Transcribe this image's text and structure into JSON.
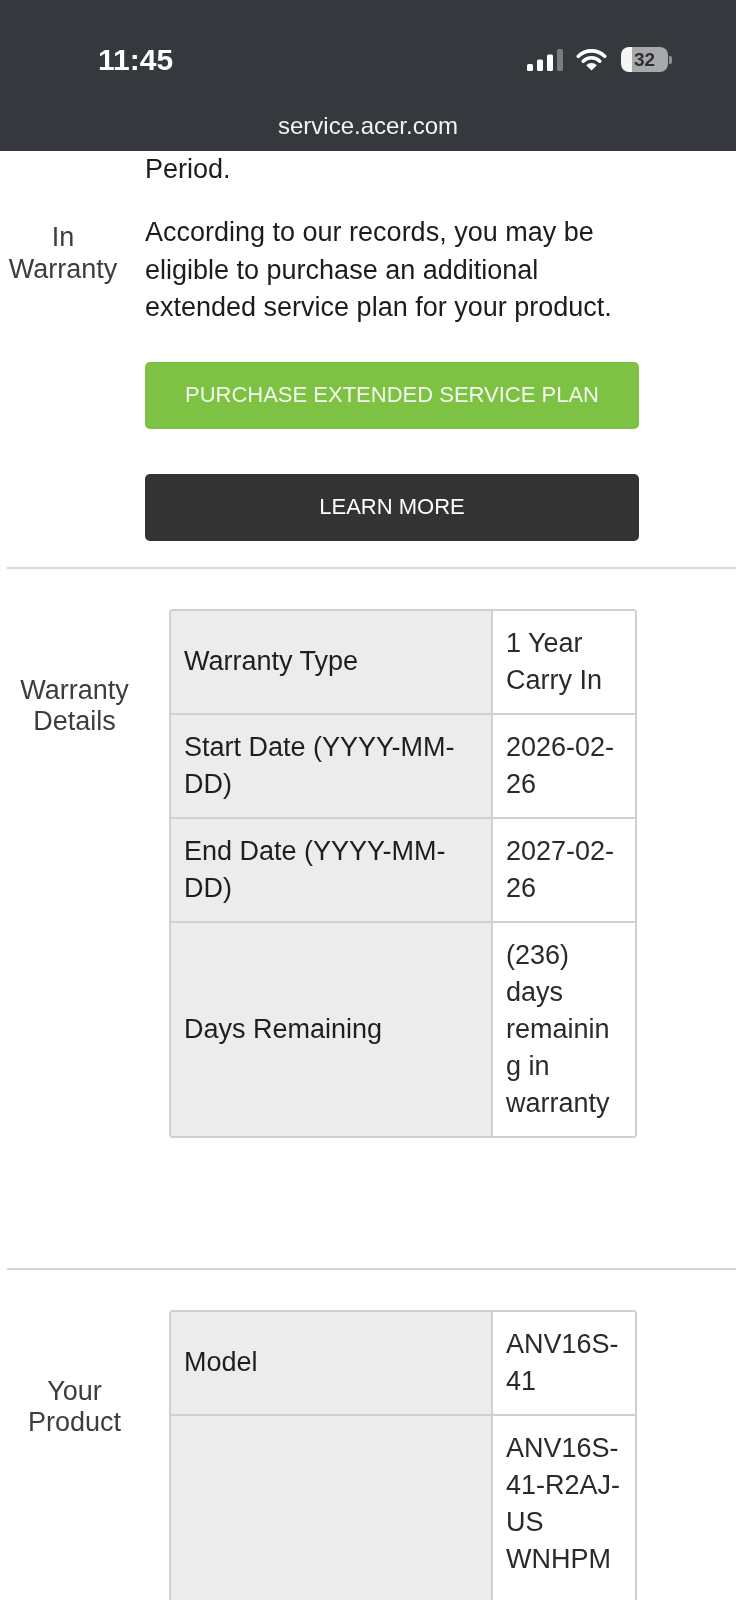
{
  "status_bar": {
    "time": "11:45",
    "battery": "32",
    "url": "service.acer.com"
  },
  "sections": [
    {
      "kind": "notice",
      "label": "In Warranty",
      "paragraphs": [
        "Period.",
        "According to our records, you may be eligible to purchase an additional extended service plan for your product."
      ],
      "buttons": [
        {
          "kind": "primary",
          "label": "PURCHASE EXTENDED SERVICE PLAN"
        },
        {
          "kind": "secondary",
          "label": "LEARN MORE"
        }
      ]
    },
    {
      "kind": "table",
      "label": "Warranty Details",
      "rows": [
        {
          "label": "Warranty Type",
          "value": "1 Year Carry In"
        },
        {
          "label": "Start Date (YYYY-MM-DD)",
          "value": "2026-02-26"
        },
        {
          "label": "End Date (YYYY-MM-DD)",
          "value": "2027-02-26"
        },
        {
          "label": "Days Remaining",
          "value": "(236) days remaining in warranty"
        }
      ]
    },
    {
      "kind": "table",
      "label": "Your Product",
      "rows": [
        {
          "label": "Model",
          "value": "ANV16S-41"
        },
        {
          "value": "ANV16S-41-R2AJ-US WNHPM"
        }
      ]
    }
  ]
}
